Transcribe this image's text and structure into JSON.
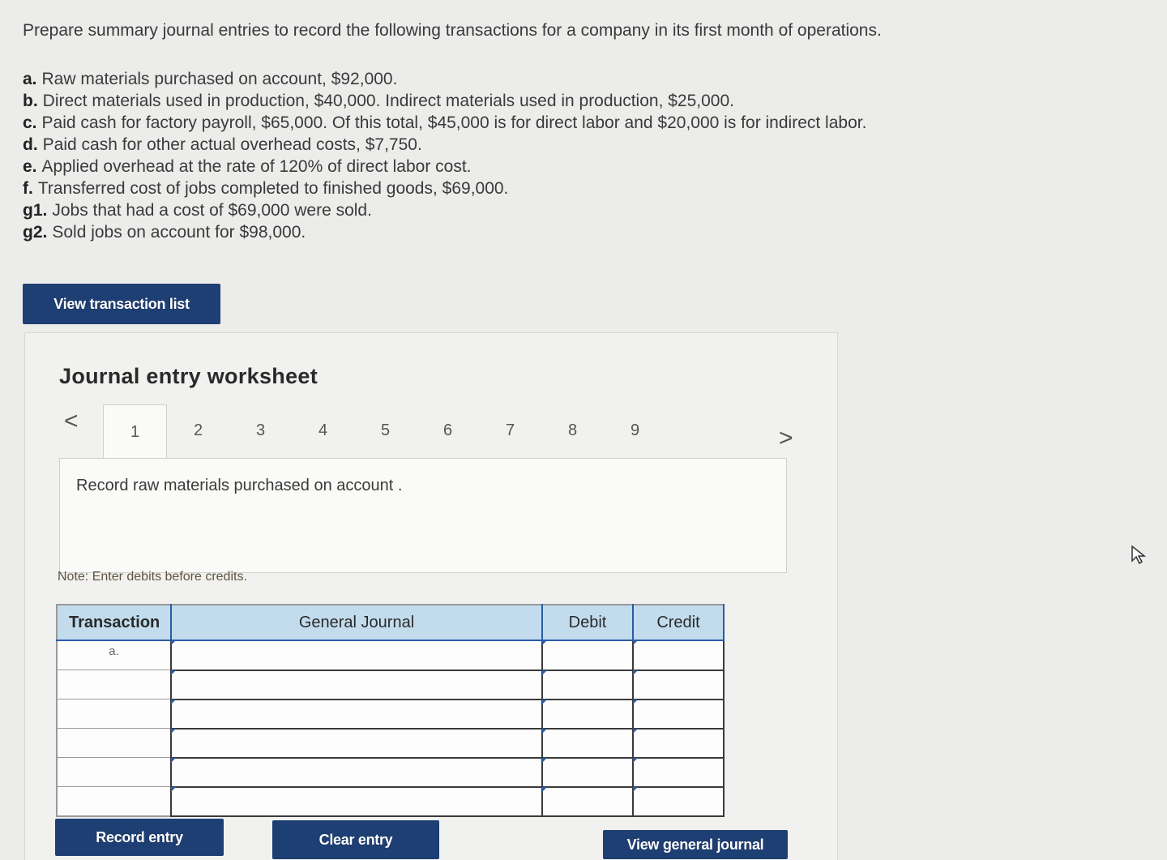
{
  "intro": "Prepare summary journal entries to record the following transactions for a company in its first month of operations.",
  "transactions": [
    {
      "letter": "a.",
      "text": "Raw materials purchased on account, $92,000."
    },
    {
      "letter": "b.",
      "text": "Direct materials used in production, $40,000. Indirect materials used in production, $25,000."
    },
    {
      "letter": "c.",
      "text": "Paid cash for factory payroll, $65,000. Of this total, $45,000 is for direct labor and $20,000 is for indirect labor."
    },
    {
      "letter": "d.",
      "text": "Paid cash for other actual overhead costs, $7,750."
    },
    {
      "letter": "e.",
      "text": "Applied overhead at the rate of 120% of direct labor cost."
    },
    {
      "letter": "f.",
      "text": "Transferred cost of jobs completed to finished goods, $69,000."
    },
    {
      "letter": "g1.",
      "text": "Jobs that had a cost of $69,000 were sold."
    },
    {
      "letter": "g2.",
      "text": "Sold jobs on account for $98,000."
    }
  ],
  "buttons": {
    "view_transaction_list": "View transaction list",
    "record_entry": "Record entry",
    "clear_entry": "Clear entry",
    "view_general_journal": "View general journal"
  },
  "worksheet": {
    "title": "Journal entry worksheet",
    "prev": "<",
    "next": ">",
    "tabs": [
      "1",
      "2",
      "3",
      "4",
      "5",
      "6",
      "7",
      "8",
      "9"
    ],
    "active_tab": "1",
    "prompt": "Record raw materials purchased on account .",
    "note": "Note: Enter debits before credits."
  },
  "journal_table": {
    "headers": {
      "transaction": "Transaction",
      "general_journal": "General Journal",
      "debit": "Debit",
      "credit": "Credit"
    },
    "rows": [
      {
        "transaction": "a.",
        "account": "",
        "debit": "",
        "credit": ""
      },
      {
        "transaction": "",
        "account": "",
        "debit": "",
        "credit": ""
      },
      {
        "transaction": "",
        "account": "",
        "debit": "",
        "credit": ""
      },
      {
        "transaction": "",
        "account": "",
        "debit": "",
        "credit": ""
      },
      {
        "transaction": "",
        "account": "",
        "debit": "",
        "credit": ""
      },
      {
        "transaction": "",
        "account": "",
        "debit": "",
        "credit": ""
      }
    ]
  },
  "colors": {
    "primary_button": "#1e3f73",
    "table_header": "#c2dced",
    "accent_blue": "#2b5aa8"
  },
  "icons": {
    "cursor": "mouse-pointer-icon"
  }
}
